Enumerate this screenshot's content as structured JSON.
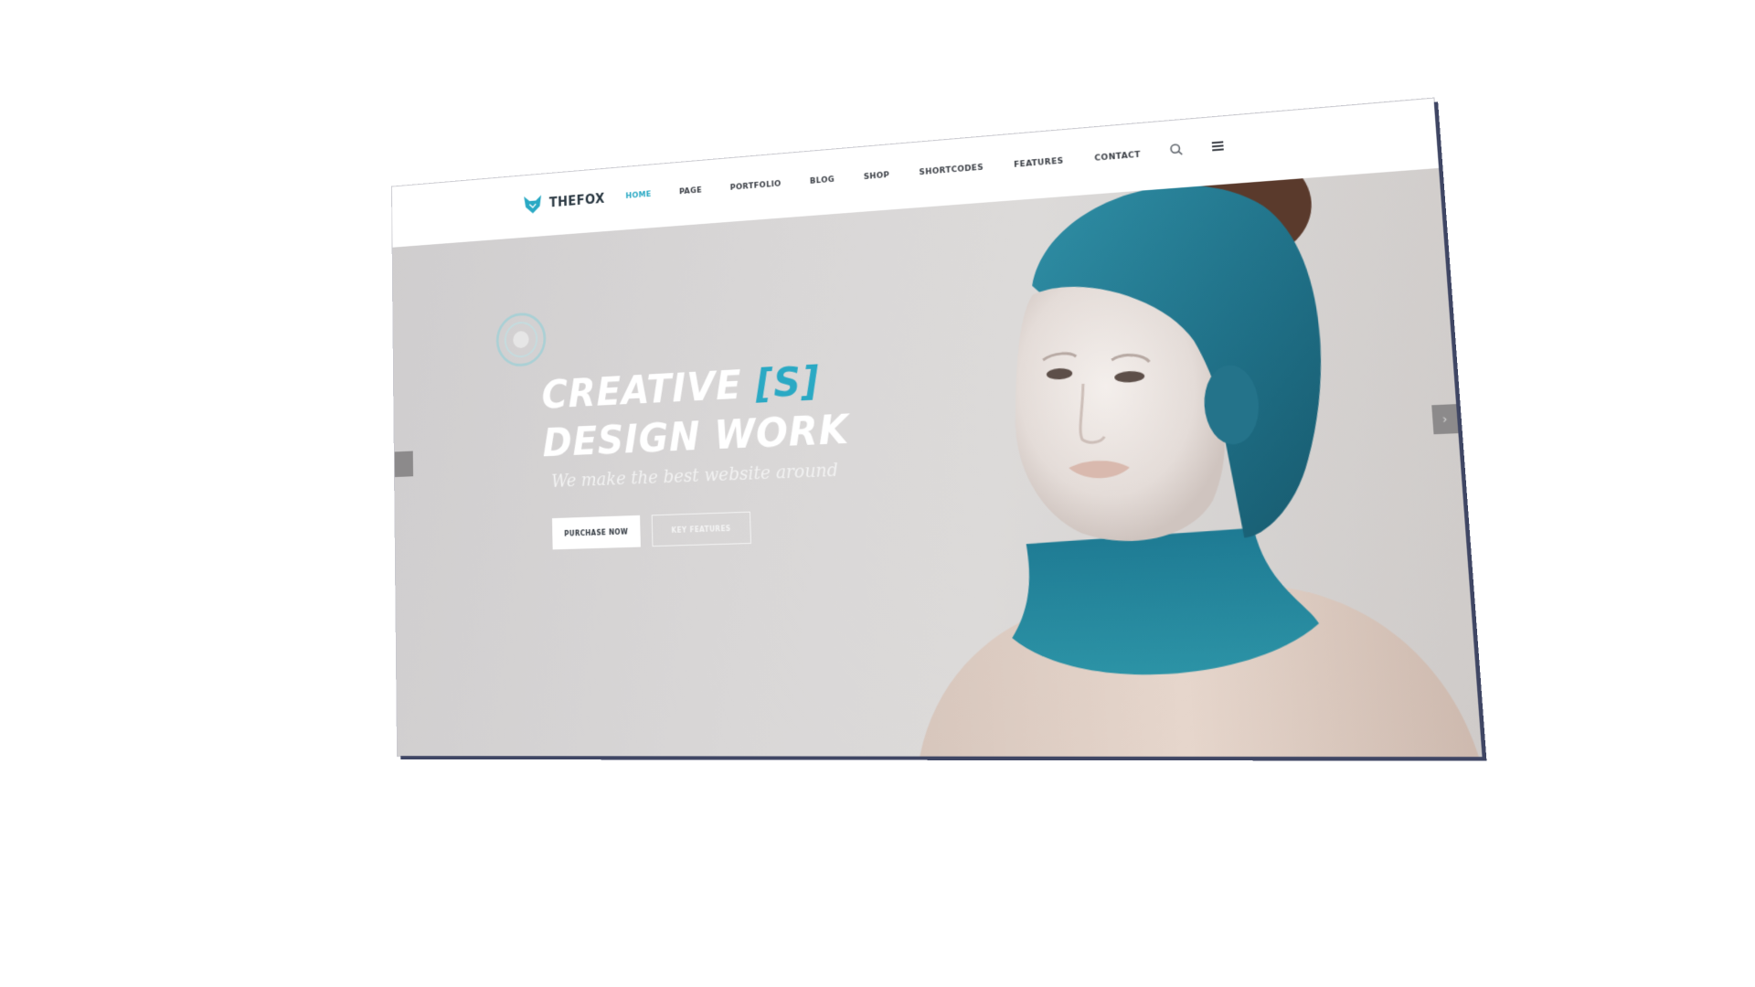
{
  "brand": {
    "name": "THEFOX",
    "accent_color": "#2aa9c4"
  },
  "nav": {
    "items": [
      {
        "label": "HOME",
        "active": true
      },
      {
        "label": "PAGE",
        "active": false
      },
      {
        "label": "PORTFOLIO",
        "active": false
      },
      {
        "label": "BLOG",
        "active": false
      },
      {
        "label": "SHOP",
        "active": false
      },
      {
        "label": "SHORTCODES",
        "active": false
      },
      {
        "label": "FEATURES",
        "active": false
      },
      {
        "label": "CONTACT",
        "active": false
      }
    ],
    "icons": [
      "search-icon",
      "menu-icon"
    ]
  },
  "hero": {
    "title_line1": "CREATIVE ",
    "title_accent": "[S]",
    "title_line2": "DESIGN WORK",
    "subtitle": "We make the best website around",
    "primary_button": "PURCHASE NOW",
    "secondary_button": "KEY FEATURES"
  },
  "slider": {
    "prev_icon": "chevron-left-icon",
    "next_icon": "chevron-right-icon",
    "next_glyph": "›"
  }
}
